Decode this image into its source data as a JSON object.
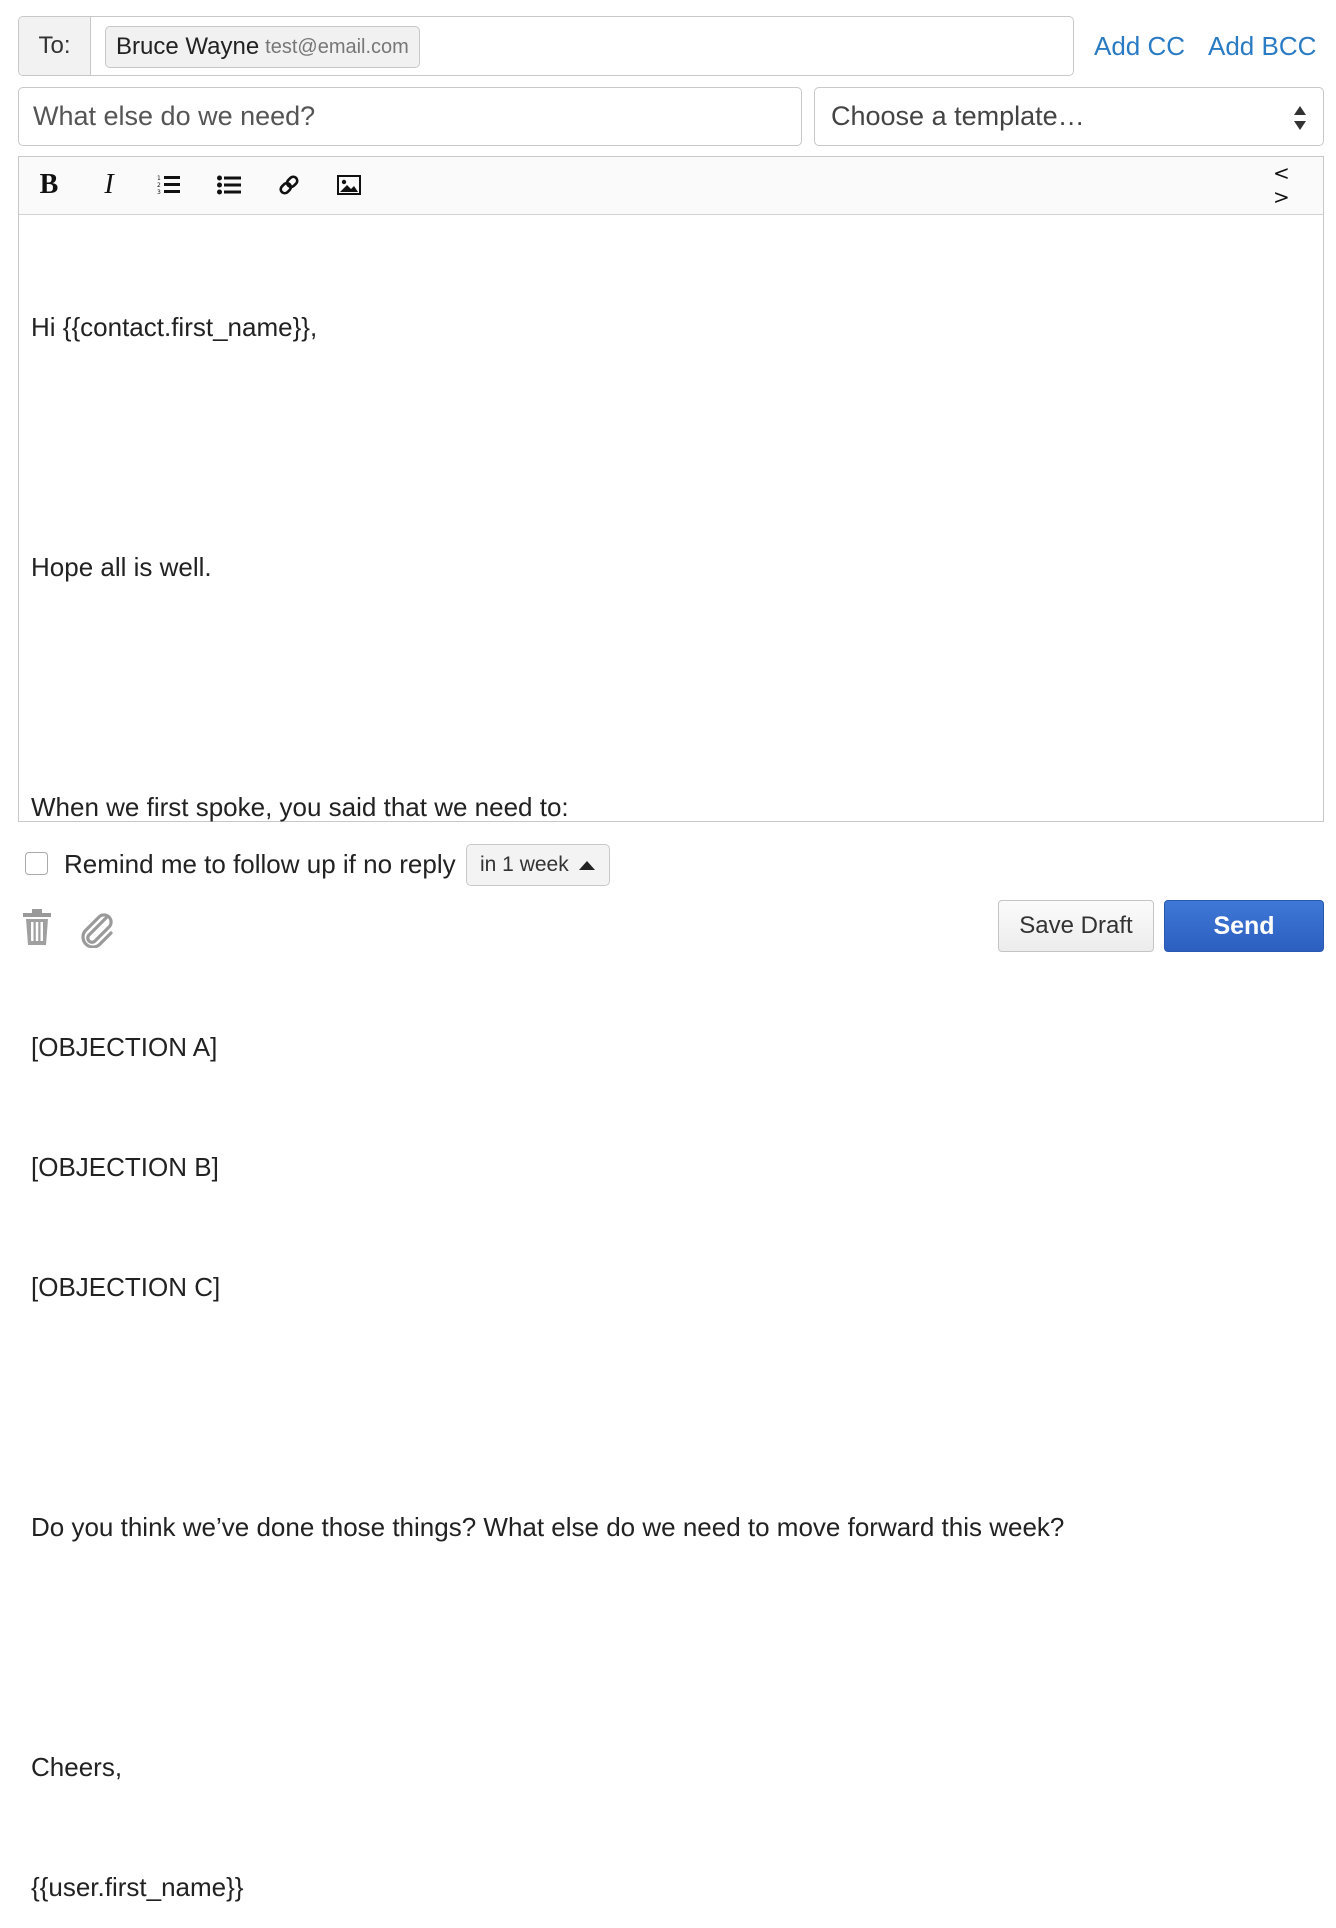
{
  "to": {
    "label": "To:",
    "recipient_name": "Bruce Wayne",
    "recipient_email": "test@email.com",
    "add_cc": "Add CC",
    "add_bcc": "Add BCC"
  },
  "subject": {
    "placeholder": "What else do we need?",
    "value": ""
  },
  "template": {
    "selected": "Choose a template…"
  },
  "toolbar": {
    "bold": "B",
    "italic": "I",
    "code": "< >",
    "icons": [
      "bold-icon",
      "italic-icon",
      "numbered-list-icon",
      "bullet-list-icon",
      "link-icon",
      "image-icon",
      "code-view-icon"
    ]
  },
  "body": {
    "lines": [
      "Hi {{contact.first_name}},",
      "",
      "Hope all is well.",
      "",
      "When we first spoke, you said that we need to:",
      "",
      "[OBJECTION A]",
      "[OBJECTION B]",
      "[OBJECTION C]",
      "",
      "Do you think we’ve done those things? What else do we need to move forward this week?",
      "",
      "Cheers,",
      "{{user.first_name}}"
    ]
  },
  "footer": {
    "remind_label": "Remind me to follow up if no reply",
    "remind_checked": false,
    "remind_interval": "in 1 week",
    "save_draft": "Save Draft",
    "send": "Send",
    "icons": [
      "trash-icon",
      "paperclip-icon"
    ]
  },
  "colors": {
    "link": "#2a7bc4",
    "send_button": "#3468c9",
    "border": "#c8c8c8"
  }
}
